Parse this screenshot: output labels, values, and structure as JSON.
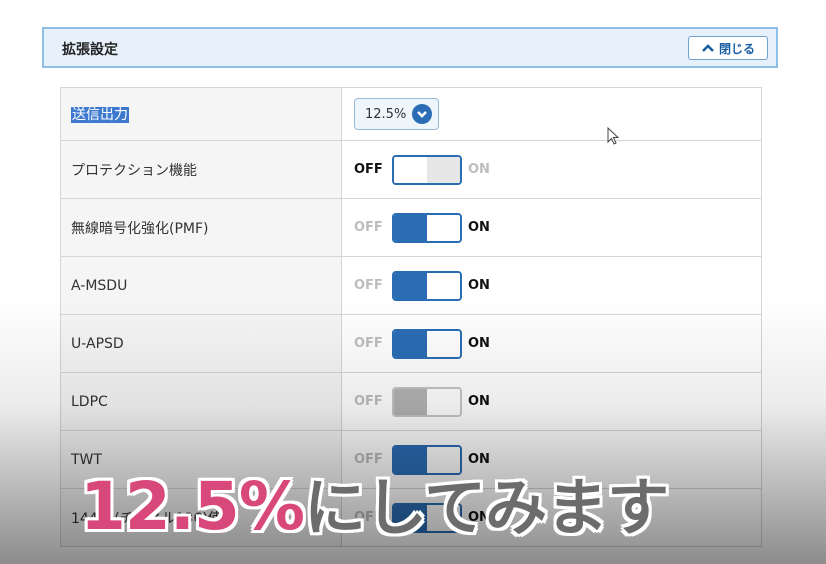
{
  "panel": {
    "title": "拡張設定",
    "close_label": "閉じる"
  },
  "rows": [
    {
      "label": "送信出力",
      "type": "select",
      "value": "12.5%"
    },
    {
      "label": "プロテクション機能",
      "type": "toggle",
      "state": "off"
    },
    {
      "label": "無線暗号化強化(PMF)",
      "type": "toggle",
      "state": "on"
    },
    {
      "label": "A-MSDU",
      "type": "toggle",
      "state": "on"
    },
    {
      "label": "U-APSD",
      "type": "toggle",
      "state": "on"
    },
    {
      "label": "LDPC",
      "type": "toggle",
      "state": "disabled"
    },
    {
      "label": "TWT",
      "type": "toggle",
      "state": "on"
    },
    {
      "label": "144ch(チャネル136)使",
      "type": "toggle",
      "state": "on"
    }
  ],
  "toggle_labels": {
    "off": "OFF",
    "on": "ON"
  },
  "caption": {
    "percent": "12.5%",
    "rest": "にしてみます"
  },
  "colors": {
    "accent": "#2a6db5",
    "header_bg": "#e6f1fb",
    "caption_pink": "#d9487a",
    "caption_gray": "#6c6c6c"
  }
}
